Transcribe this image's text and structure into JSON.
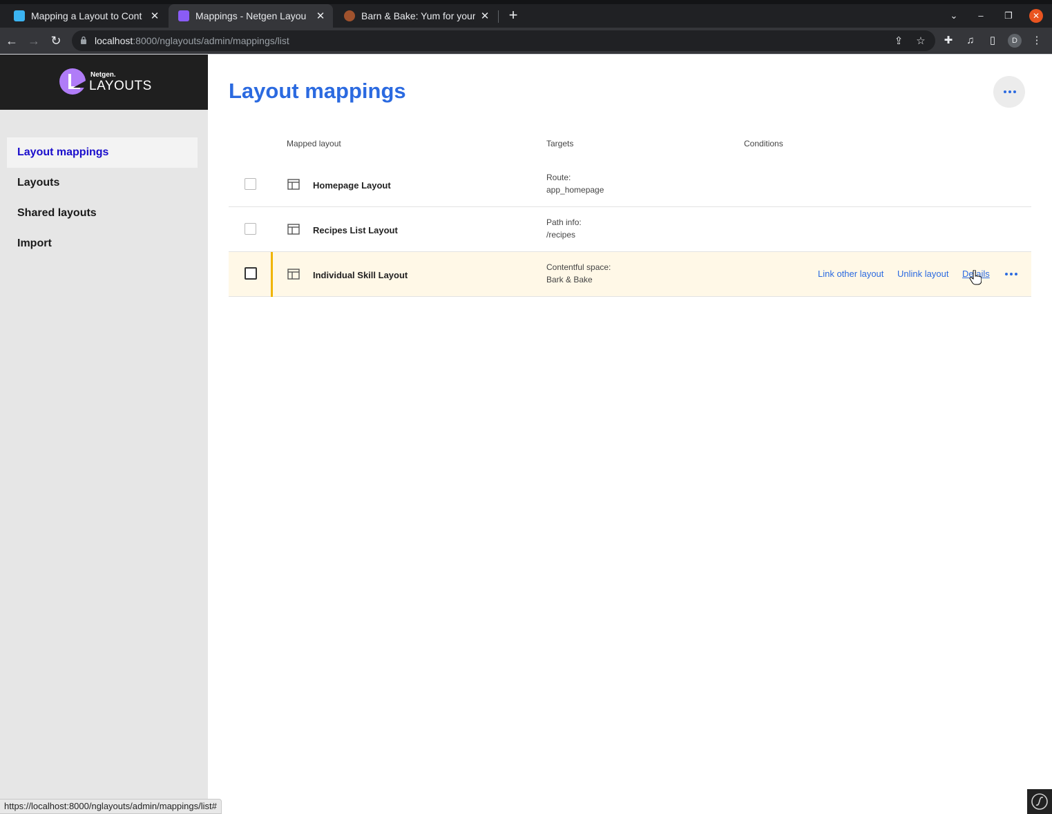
{
  "browser": {
    "tabs": [
      {
        "title": "Mapping a Layout to Cont",
        "favicon_color": "#3bb4f2"
      },
      {
        "title": "Mappings - Netgen Layou",
        "favicon_color": "#8a5cf6"
      },
      {
        "title": "Barn & Bake: Yum for your",
        "favicon_color": "#a0522d"
      }
    ],
    "url_host": "localhost",
    "url_rest": ":8000/nglayouts/admin/mappings/list",
    "profile_initial": "D",
    "status_url": "https://localhost:8000/nglayouts/admin/mappings/list#"
  },
  "brand": {
    "small": "Netgen.",
    "large": "LAYOUTS"
  },
  "sidebar": {
    "items": [
      {
        "label": "Layout mappings",
        "active": true
      },
      {
        "label": "Layouts",
        "active": false
      },
      {
        "label": "Shared layouts",
        "active": false
      },
      {
        "label": "Import",
        "active": false
      }
    ]
  },
  "main": {
    "title": "Layout mappings",
    "columns": {
      "mapped_layout": "Mapped layout",
      "targets": "Targets",
      "conditions": "Conditions"
    },
    "rows": [
      {
        "name": "Homepage Layout",
        "target_type": "Route:",
        "target_value": "app_homepage"
      },
      {
        "name": "Recipes List Layout",
        "target_type": "Path info:",
        "target_value": "/recipes"
      },
      {
        "name": "Individual Skill Layout",
        "target_type": "Contentful space:",
        "target_value": "Bark & Bake"
      }
    ],
    "row_actions": {
      "link_other": "Link other layout",
      "unlink": "Unlink layout",
      "details": "Details"
    }
  },
  "colors": {
    "accent": "#2b6ae0",
    "highlight_row": "#fff8e7",
    "highlight_bar": "#f0b400"
  }
}
